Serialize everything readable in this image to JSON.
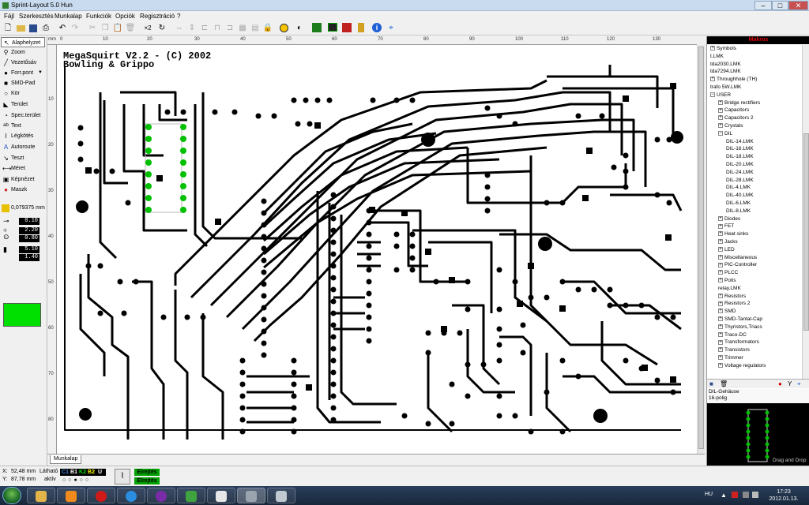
{
  "window": {
    "title": "Sprint-Layout 5.0 Hun"
  },
  "menu": [
    "Fájl",
    "Szerkesztés",
    "Munkalap",
    "Funkciók",
    "Opciók",
    "Regisztráció",
    "?"
  ],
  "toolbar": {
    "multiplier": "×2"
  },
  "tools": [
    {
      "label": "Alaphelyzet",
      "icon": "cursor-icon",
      "glyph": "↖"
    },
    {
      "label": "Zoom",
      "icon": "zoom-icon",
      "glyph": "⚲"
    },
    {
      "label": "Vezetősáv",
      "icon": "track-icon",
      "glyph": "╱"
    },
    {
      "label": "Forr.pont",
      "icon": "pad-icon",
      "glyph": "●"
    },
    {
      "label": "SMD-Pad",
      "icon": "smd-pad-icon",
      "glyph": "■"
    },
    {
      "label": "Kör",
      "icon": "circle-icon",
      "glyph": "○"
    },
    {
      "label": "Terület",
      "icon": "area-icon",
      "glyph": "◣"
    },
    {
      "label": "Spec.terület",
      "icon": "special-area-icon",
      "glyph": "◔"
    },
    {
      "label": "Text",
      "icon": "text-icon",
      "glyph": "ab"
    },
    {
      "label": "Légkötés",
      "icon": "airwire-icon",
      "glyph": "⌇"
    },
    {
      "label": "Autoroute",
      "icon": "autoroute-icon",
      "glyph": "A"
    },
    {
      "label": "Teszt",
      "icon": "test-icon",
      "glyph": "↘"
    },
    {
      "label": "Méret",
      "icon": "measure-icon",
      "glyph": "⟷"
    },
    {
      "label": "Képnézet",
      "icon": "photoview-icon",
      "glyph": "▣"
    },
    {
      "label": "Maszk",
      "icon": "mask-icon",
      "glyph": "●"
    }
  ],
  "grid": {
    "value": "0,079375 mm"
  },
  "params": [
    "0.10",
    "2.20",
    "0.80",
    "5.10",
    "1.40"
  ],
  "board": {
    "title_line1": "MegaSquirt V2.2 - (C) 2002",
    "title_line2": "Bowling & Grippo"
  },
  "ruler": {
    "unit": "mm",
    "top_ticks": [
      "0",
      "10",
      "20",
      "30",
      "40",
      "50",
      "60",
      "70",
      "80",
      "90",
      "100",
      "110",
      "120",
      "130"
    ],
    "left_ticks": [
      "10",
      "20",
      "30",
      "40",
      "50",
      "60",
      "70",
      "80"
    ]
  },
  "tab": {
    "label": "Munkalap"
  },
  "macros": {
    "header": "Makros",
    "tree": [
      {
        "label": "Symbols",
        "expander": "+",
        "level": 0
      },
      {
        "label": "t.LMK",
        "expander": "",
        "level": 0
      },
      {
        "label": "tda2030.LMK",
        "expander": "",
        "level": 0
      },
      {
        "label": "tda7294.LMK",
        "expander": "",
        "level": 0
      },
      {
        "label": "Throughhole (TH)",
        "expander": "+",
        "level": 0
      },
      {
        "label": "trafo 5W.LMK",
        "expander": "",
        "level": 0
      },
      {
        "label": "USER",
        "expander": "−",
        "level": 0
      },
      {
        "label": "Bridge rectifiers",
        "expander": "+",
        "level": 1
      },
      {
        "label": "Capacitors",
        "expander": "+",
        "level": 1
      },
      {
        "label": "Capacitors 2",
        "expander": "+",
        "level": 1
      },
      {
        "label": "Crystals",
        "expander": "+",
        "level": 1
      },
      {
        "label": "DIL",
        "expander": "−",
        "level": 1
      },
      {
        "label": "DIL-14.LMK",
        "expander": "",
        "level": 2
      },
      {
        "label": "DIL-16.LMK",
        "expander": "",
        "level": 2
      },
      {
        "label": "DIL-18.LMK",
        "expander": "",
        "level": 2
      },
      {
        "label": "DIL-20.LMK",
        "expander": "",
        "level": 2
      },
      {
        "label": "DIL-24.LMK",
        "expander": "",
        "level": 2
      },
      {
        "label": "DIL-28.LMK",
        "expander": "",
        "level": 2
      },
      {
        "label": "DIL-4.LMK",
        "expander": "",
        "level": 2
      },
      {
        "label": "DIL-40.LMK",
        "expander": "",
        "level": 2
      },
      {
        "label": "DIL-6.LMK",
        "expander": "",
        "level": 2
      },
      {
        "label": "DIL-8.LMK",
        "expander": "",
        "level": 2
      },
      {
        "label": "Diodes",
        "expander": "+",
        "level": 1
      },
      {
        "label": "FET",
        "expander": "+",
        "level": 1
      },
      {
        "label": "Heat sinks",
        "expander": "+",
        "level": 1
      },
      {
        "label": "Jacks",
        "expander": "+",
        "level": 1
      },
      {
        "label": "LED",
        "expander": "+",
        "level": 1
      },
      {
        "label": "Miscellaneous",
        "expander": "+",
        "level": 1
      },
      {
        "label": "PIC-Controller",
        "expander": "+",
        "level": 1
      },
      {
        "label": "PLCC",
        "expander": "+",
        "level": 1
      },
      {
        "label": "Potis",
        "expander": "+",
        "level": 1
      },
      {
        "label": "relay.LMK",
        "expander": "",
        "level": 1
      },
      {
        "label": "Resistors",
        "expander": "+",
        "level": 1
      },
      {
        "label": "Resistors 2",
        "expander": "+",
        "level": 1
      },
      {
        "label": "SMD",
        "expander": "+",
        "level": 1
      },
      {
        "label": "SMD-Tantal-Cap",
        "expander": "+",
        "level": 1
      },
      {
        "label": "Thyristors,Triacs",
        "expander": "+",
        "level": 1
      },
      {
        "label": "Traco-DC",
        "expander": "+",
        "level": 1
      },
      {
        "label": "Transformators",
        "expander": "+",
        "level": 1
      },
      {
        "label": "Transistors",
        "expander": "+",
        "level": 1
      },
      {
        "label": "Trimmer",
        "expander": "+",
        "level": 1
      },
      {
        "label": "Voltage regulators",
        "expander": "+",
        "level": 1
      }
    ],
    "info_line1": "DIL-Gehäuse",
    "info_line2": "16-polig",
    "preview_hint": "Drag and Drop"
  },
  "status": {
    "x_label": "X:",
    "x_value": "52,48 mm",
    "y_label": "Y:",
    "y_value": "87,78 mm",
    "visible_label": "Látható",
    "active_label": "aktív",
    "layers": [
      {
        "name": "C1",
        "color": "#3a7bd5"
      },
      {
        "name": "B1",
        "color": "#ffffff"
      },
      {
        "name": "K2",
        "color": "#00e000"
      },
      {
        "name": "B2",
        "color": "#ffff00"
      },
      {
        "name": "U",
        "color": "#ffffff"
      }
    ],
    "badge1": "Elrejtés",
    "badge2": "Elrejtés"
  },
  "taskbar": {
    "lang": "HU",
    "time": "17:23",
    "date": "2012.01.13."
  },
  "colors": {
    "accent_green": "#00e000",
    "pcb_copper": "#000000",
    "selection": "#00c000"
  }
}
